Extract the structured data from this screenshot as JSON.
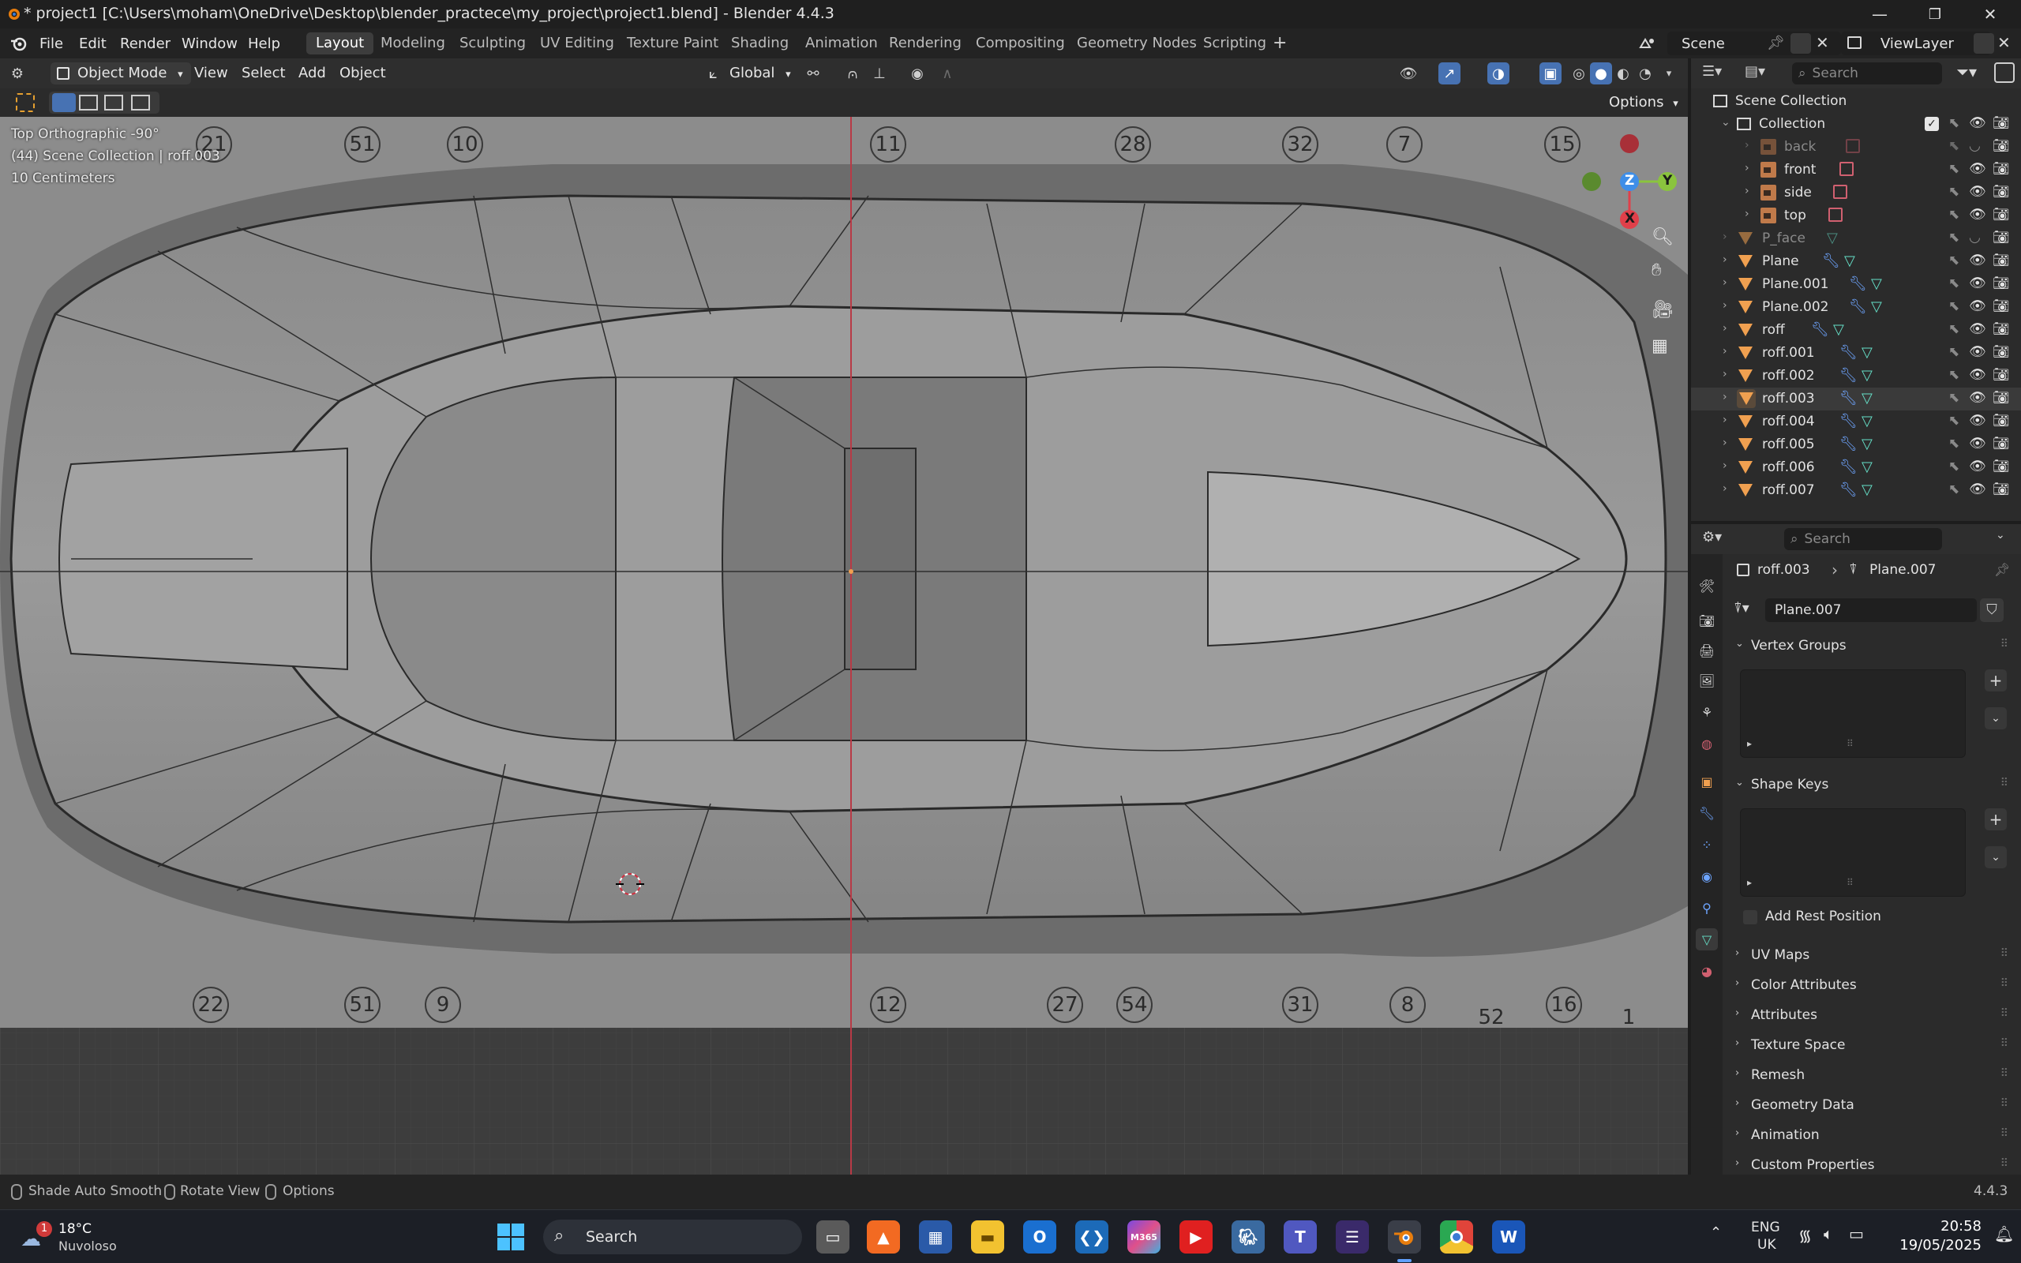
{
  "titlebar": {
    "title": "* project1 [C:\\Users\\moham\\OneDrive\\Desktop\\blender_practece\\my_project\\project1.blend] - Blender 4.4.3",
    "minimize": "—",
    "maximize": "❐",
    "close": "✕"
  },
  "menu": {
    "file": "File",
    "edit": "Edit",
    "render": "Render",
    "window": "Window",
    "help": "Help"
  },
  "workspaces": [
    "Layout",
    "Modeling",
    "Sculpting",
    "UV Editing",
    "Texture Paint",
    "Shading",
    "Animation",
    "Rendering",
    "Compositing",
    "Geometry Nodes",
    "Scripting"
  ],
  "active_workspace": "Layout",
  "scene": {
    "name": "Scene",
    "view_layer": "ViewLayer"
  },
  "viewport_header": {
    "mode": "Object Mode",
    "view": "View",
    "select": "Select",
    "add": "Add",
    "object": "Object",
    "transform_orientation": "Global",
    "options": "Options"
  },
  "viewport": {
    "view_name": "Top Orthographic -90°",
    "collection_info": "(44) Scene Collection | roff.003",
    "scale": "10 Centimeters",
    "gizmo": {
      "x": "X",
      "y": "Y",
      "z": "Z"
    },
    "blueprint_numbers_top": [
      "21",
      "51",
      "10",
      "11",
      "28",
      "32",
      "7",
      "15"
    ],
    "blueprint_numbers_bottom": [
      "22",
      "51",
      "9",
      "12",
      "27",
      "54",
      "31",
      "8",
      "16",
      "52",
      "1"
    ]
  },
  "outliner": {
    "search_placeholder": "Search",
    "root": "Scene Collection",
    "collection": "Collection",
    "items": [
      {
        "name": "back",
        "type": "image",
        "level": 2,
        "dim": true
      },
      {
        "name": "front",
        "type": "image",
        "level": 2,
        "dim": false
      },
      {
        "name": "side",
        "type": "image",
        "level": 2,
        "dim": false
      },
      {
        "name": "top",
        "type": "image",
        "level": 2,
        "dim": false
      },
      {
        "name": "P_face",
        "type": "mesh",
        "level": 1,
        "dim": true,
        "modifier": false
      },
      {
        "name": "Plane",
        "type": "mesh",
        "level": 1,
        "modifier": true
      },
      {
        "name": "Plane.001",
        "type": "mesh",
        "level": 1,
        "modifier": true
      },
      {
        "name": "Plane.002",
        "type": "mesh",
        "level": 1,
        "modifier": true
      },
      {
        "name": "roff",
        "type": "mesh",
        "level": 1,
        "modifier": true
      },
      {
        "name": "roff.001",
        "type": "mesh",
        "level": 1,
        "modifier": true
      },
      {
        "name": "roff.002",
        "type": "mesh",
        "level": 1,
        "modifier": true
      },
      {
        "name": "roff.003",
        "type": "mesh",
        "level": 1,
        "modifier": true,
        "selected": true
      },
      {
        "name": "roff.004",
        "type": "mesh",
        "level": 1,
        "modifier": true
      },
      {
        "name": "roff.005",
        "type": "mesh",
        "level": 1,
        "modifier": true
      },
      {
        "name": "roff.006",
        "type": "mesh",
        "level": 1,
        "modifier": true
      },
      {
        "name": "roff.007",
        "type": "mesh",
        "level": 1,
        "modifier": true
      }
    ]
  },
  "properties": {
    "search_placeholder": "Search",
    "breadcrumb_object": "roff.003",
    "breadcrumb_data": "Plane.007",
    "mesh_name": "Plane.007",
    "sections": {
      "vertex_groups": "Vertex Groups",
      "shape_keys": "Shape Keys",
      "add_rest_position": "Add Rest Position",
      "uv_maps": "UV Maps",
      "color_attributes": "Color Attributes",
      "attributes": "Attributes",
      "texture_space": "Texture Space",
      "remesh": "Remesh",
      "geometry_data": "Geometry Data",
      "animation": "Animation",
      "custom_properties": "Custom Properties"
    }
  },
  "statusbar": {
    "shade_auto_smooth": "Shade Auto Smooth",
    "rotate_view": "Rotate View",
    "options": "Options",
    "version": "4.4.3"
  },
  "taskbar": {
    "weather_temp": "18°C",
    "weather_desc": "Nuvoloso",
    "weather_badge": "1",
    "search": "Search",
    "lang_top": "ENG",
    "lang_bottom": "UK",
    "time": "20:58",
    "date": "19/05/2025",
    "copilot_label": "M365"
  },
  "colors": {
    "accent_blue": "#4772b3",
    "object_orange": "#f0a050",
    "axis_red": "#e0404a",
    "axis_green": "#8ac43e",
    "axis_blue": "#3e8ee8"
  }
}
